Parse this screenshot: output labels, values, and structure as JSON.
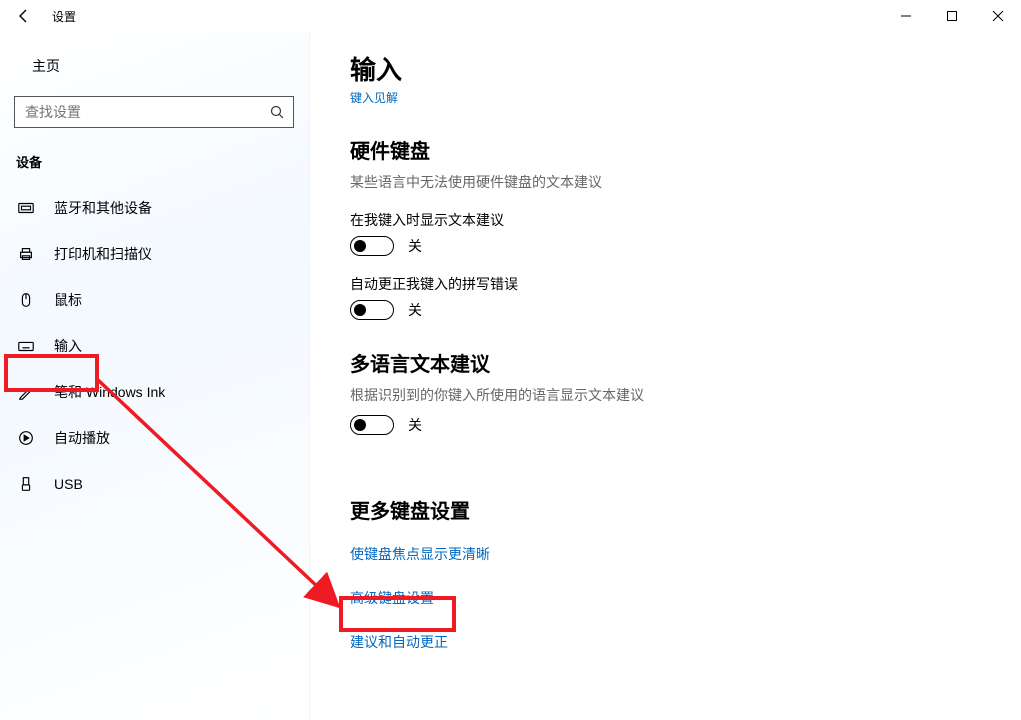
{
  "titlebar": {
    "title": "设置"
  },
  "sidebar": {
    "home": "主页",
    "search_placeholder": "查找设置",
    "group": "设备",
    "items": [
      {
        "key": "bluetooth",
        "label": "蓝牙和其他设备"
      },
      {
        "key": "printers",
        "label": "打印机和扫描仪"
      },
      {
        "key": "mouse",
        "label": "鼠标"
      },
      {
        "key": "typing",
        "label": "输入"
      },
      {
        "key": "pen",
        "label": "笔和 Windows Ink"
      },
      {
        "key": "autoplay",
        "label": "自动播放"
      },
      {
        "key": "usb",
        "label": "USB"
      }
    ]
  },
  "page": {
    "title": "输入",
    "sublink": "键入见解",
    "hardware": {
      "heading": "硬件键盘",
      "sub": "某些语言中无法使用硬件键盘的文本建议",
      "opt1_label": "在我键入时显示文本建议",
      "opt1_state": "关",
      "opt2_label": "自动更正我键入的拼写错误",
      "opt2_state": "关"
    },
    "multilang": {
      "heading": "多语言文本建议",
      "sub": "根据识别到的你键入所使用的语言显示文本建议",
      "opt_state": "关"
    },
    "more": {
      "heading": "更多键盘设置",
      "link1": "使键盘焦点显示更清晰",
      "link2": "高级键盘设置",
      "link3": "建议和自动更正"
    }
  }
}
